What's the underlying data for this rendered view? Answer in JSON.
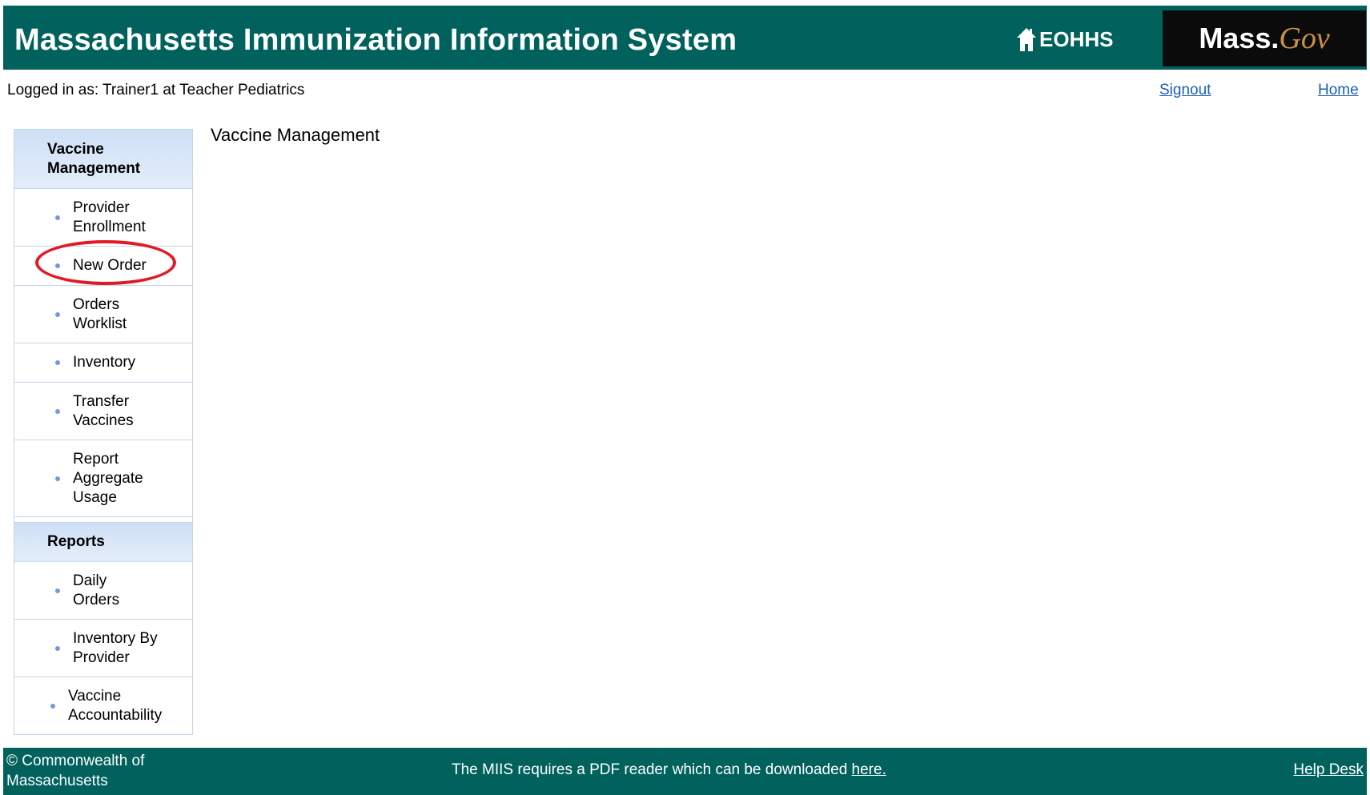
{
  "header": {
    "title": "Massachusetts Immunization Information System",
    "eohhs_label": "EOHHS",
    "massgov_mass": "Mass.",
    "massgov_gov": "Gov"
  },
  "user_bar": {
    "logged_in_text": "Logged in as: Trainer1 at Teacher Pediatrics",
    "signout_label": "Signout",
    "home_label": "Home"
  },
  "sidebar": {
    "vaccine_management": {
      "heading_line1": "Vaccine",
      "heading_line2": "Management",
      "items": [
        {
          "line1": "Provider",
          "line2": "Enrollment"
        },
        {
          "line1": "New Order"
        },
        {
          "line1": "Orders",
          "line2": "Worklist"
        },
        {
          "line1": "Inventory"
        },
        {
          "line1": "Transfer",
          "line2": "Vaccines"
        },
        {
          "line1": "Report",
          "line2": "Aggregate",
          "line3": "Usage"
        }
      ]
    },
    "reports": {
      "heading": "Reports",
      "items": [
        {
          "line1": "Daily",
          "line2": "Orders"
        },
        {
          "line1": "Inventory By",
          "line2": "Provider"
        },
        {
          "line1": "Vaccine",
          "line2": "Accountability"
        }
      ]
    }
  },
  "main": {
    "title": "Vaccine Management"
  },
  "footer": {
    "copyright_line1": "© Commonwealth of",
    "copyright_line2": "Massachusetts",
    "pdf_note": "The MIIS requires a PDF reader which can be downloaded ",
    "pdf_link": "here.",
    "help_desk": "Help Desk"
  },
  "colors": {
    "header_bg": "#00615d",
    "sidebar_header_bg": "#d6e4f7",
    "link": "#1a5fb4",
    "highlight_circle": "#e01b24"
  }
}
